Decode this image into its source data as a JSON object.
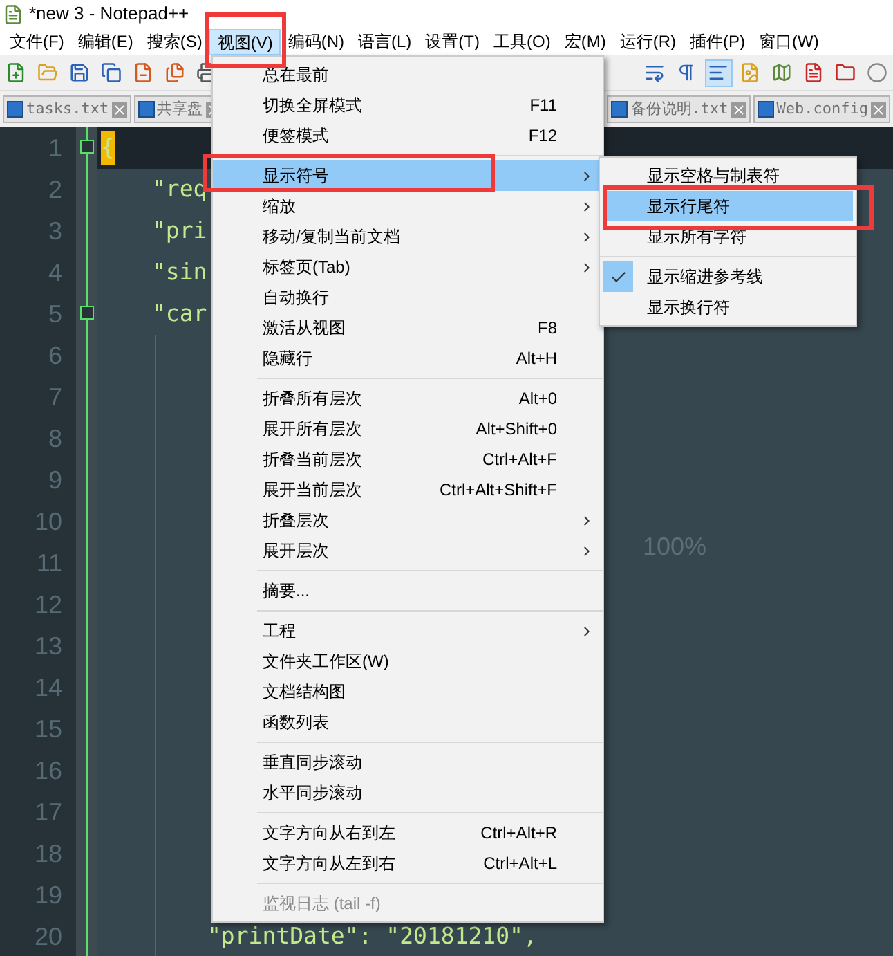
{
  "window": {
    "title": "*new 3 - Notepad++"
  },
  "menubar": [
    {
      "label": "文件(F)",
      "selected": false
    },
    {
      "label": "编辑(E)",
      "selected": false
    },
    {
      "label": "搜索(S)",
      "selected": false
    },
    {
      "label": "视图(V)",
      "selected": true
    },
    {
      "label": "编码(N)",
      "selected": false
    },
    {
      "label": "语言(L)",
      "selected": false
    },
    {
      "label": "设置(T)",
      "selected": false
    },
    {
      "label": "工具(O)",
      "selected": false
    },
    {
      "label": "宏(M)",
      "selected": false
    },
    {
      "label": "运行(R)",
      "selected": false
    },
    {
      "label": "插件(P)",
      "selected": false
    },
    {
      "label": "窗口(W)",
      "selected": false
    }
  ],
  "tabs": [
    {
      "label": "tasks.txt",
      "selected": false
    },
    {
      "label": "共享盘",
      "selected": false
    },
    {
      "label": "备份说明.txt",
      "selected": false
    },
    {
      "label": "Web.config",
      "selected": false
    }
  ],
  "editor": {
    "lines": [
      {
        "number": "1",
        "code": "{",
        "current": true
      },
      {
        "number": "2",
        "code": "\"req",
        "current": false
      },
      {
        "number": "3",
        "code": "\"pri",
        "current": false
      },
      {
        "number": "4",
        "code": "\"sin",
        "current": false
      },
      {
        "number": "5",
        "code": "\"car",
        "current": false
      },
      {
        "number": "6",
        "current": false
      },
      {
        "number": "7",
        "current": false
      },
      {
        "number": "8",
        "current": false
      },
      {
        "number": "9",
        "current": false
      },
      {
        "number": "10",
        "current": false
      },
      {
        "number": "11",
        "current": false
      },
      {
        "number": "12",
        "current": false
      },
      {
        "number": "13",
        "current": false
      },
      {
        "number": "14",
        "current": false
      },
      {
        "number": "15",
        "current": false
      },
      {
        "number": "16",
        "current": false
      },
      {
        "number": "17",
        "current": false
      },
      {
        "number": "18",
        "current": false
      },
      {
        "number": "19",
        "current": false
      },
      {
        "number": "20",
        "code": "\"printDate\": \"20181210\",",
        "current": false
      }
    ],
    "zoom_label": "100%"
  },
  "view_menu": {
    "groups": [
      [
        {
          "label": "总在最前",
          "submenu": false,
          "selected": false,
          "disabled": false
        },
        {
          "label": "切换全屏模式",
          "shortcut": "F11",
          "submenu": false,
          "selected": false,
          "disabled": false
        },
        {
          "label": "便签模式",
          "shortcut": "F12",
          "submenu": false,
          "selected": false,
          "disabled": false
        }
      ],
      [
        {
          "label": "显示符号",
          "submenu": true,
          "selected": true,
          "disabled": false
        },
        {
          "label": "缩放",
          "submenu": true,
          "selected": false,
          "disabled": false
        },
        {
          "label": "移动/复制当前文档",
          "submenu": true,
          "selected": false,
          "disabled": false
        },
        {
          "label": "标签页(Tab)",
          "submenu": true,
          "selected": false,
          "disabled": false
        },
        {
          "label": "自动换行",
          "submenu": false,
          "selected": false,
          "disabled": false
        },
        {
          "label": "激活从视图",
          "shortcut": "F8",
          "submenu": false,
          "selected": false,
          "disabled": false
        },
        {
          "label": "隐藏行",
          "shortcut": "Alt+H",
          "submenu": false,
          "selected": false,
          "disabled": false
        }
      ],
      [
        {
          "label": "折叠所有层次",
          "shortcut": "Alt+0",
          "submenu": false,
          "selected": false,
          "disabled": false
        },
        {
          "label": "展开所有层次",
          "shortcut": "Alt+Shift+0",
          "submenu": false,
          "selected": false,
          "disabled": false
        },
        {
          "label": "折叠当前层次",
          "shortcut": "Ctrl+Alt+F",
          "submenu": false,
          "selected": false,
          "disabled": false
        },
        {
          "label": "展开当前层次",
          "shortcut": "Ctrl+Alt+Shift+F",
          "submenu": false,
          "selected": false,
          "disabled": false
        },
        {
          "label": "折叠层次",
          "submenu": true,
          "selected": false,
          "disabled": false
        },
        {
          "label": "展开层次",
          "submenu": true,
          "selected": false,
          "disabled": false
        }
      ],
      [
        {
          "label": "摘要...",
          "submenu": false,
          "selected": false,
          "disabled": false
        }
      ],
      [
        {
          "label": "工程",
          "submenu": true,
          "selected": false,
          "disabled": false
        },
        {
          "label": "文件夹工作区(W)",
          "submenu": false,
          "selected": false,
          "disabled": false
        },
        {
          "label": "文档结构图",
          "submenu": false,
          "selected": false,
          "disabled": false
        },
        {
          "label": "函数列表",
          "submenu": false,
          "selected": false,
          "disabled": false
        }
      ],
      [
        {
          "label": "垂直同步滚动",
          "submenu": false,
          "selected": false,
          "disabled": false
        },
        {
          "label": "水平同步滚动",
          "submenu": false,
          "selected": false,
          "disabled": false
        }
      ],
      [
        {
          "label": "文字方向从右到左",
          "shortcut": "Ctrl+Alt+R",
          "submenu": false,
          "selected": false,
          "disabled": false
        },
        {
          "label": "文字方向从左到右",
          "shortcut": "Ctrl+Alt+L",
          "submenu": false,
          "selected": false,
          "disabled": false
        }
      ],
      [
        {
          "label": "监视日志 (tail -f)",
          "submenu": false,
          "selected": false,
          "disabled": true
        }
      ]
    ]
  },
  "symbol_submenu": {
    "groups": [
      [
        {
          "label": "显示空格与制表符",
          "checked": false,
          "selected": false
        },
        {
          "label": "显示行尾符",
          "checked": false,
          "selected": true
        },
        {
          "label": "显示所有字符",
          "checked": false,
          "selected": false
        }
      ],
      [
        {
          "label": "显示缩进参考线",
          "checked": true,
          "selected": false
        },
        {
          "label": "显示换行符",
          "checked": false,
          "selected": false
        }
      ]
    ]
  }
}
